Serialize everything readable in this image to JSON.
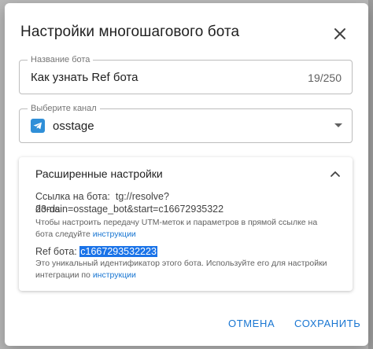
{
  "dialog": {
    "title": "Настройки многошагового бота",
    "close_icon": "close-icon"
  },
  "name_field": {
    "label": "Название бота",
    "value": "Как узнать Ref бота",
    "counter": "19/250"
  },
  "channel_field": {
    "label": "Выберите канал",
    "value": "osstage",
    "icon": "telegram-icon",
    "icon_color": "#2f8fd8"
  },
  "advanced": {
    "title": "Расширенные настройки",
    "bot_link_label": "Ссылка на бота:",
    "bot_link_value_line1": "tg://resolve?domain=osstage_bot&start=c16672935322",
    "bot_link_value_line2": "23-ds",
    "bot_link_hint_line1": "Чтобы настроить передачу UTM-меток и параметров в прямой ссылке на",
    "bot_link_hint_line2": "бота следуйте",
    "bot_link_hint_link": "инструкции",
    "ref_label": "Ref бота:",
    "ref_value": "c1667293532223",
    "ref_hint_line1": "Это уникальный идентификатор этого бота. Используйте его для настройки",
    "ref_hint_line2": "интеграции по",
    "ref_hint_link": "инструкции"
  },
  "actions": {
    "cancel_label": "ОТМЕНА",
    "save_label": "СОХРАНИТЬ"
  },
  "colors": {
    "accent": "#1976d2",
    "selection": "#1a73e8"
  }
}
